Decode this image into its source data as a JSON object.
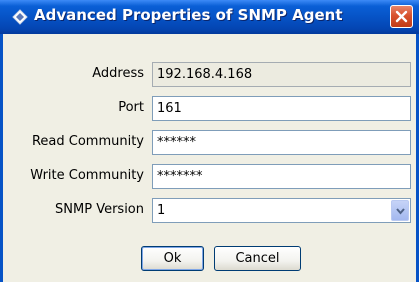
{
  "window": {
    "title": "Advanced Properties of SNMP Agent",
    "icon": "diamond-app-icon",
    "close_icon": "close-icon"
  },
  "form": {
    "address": {
      "label": "Address",
      "value": "192.168.4.168"
    },
    "port": {
      "label": "Port",
      "value": "161"
    },
    "read_community": {
      "label": "Read Community",
      "value": "******"
    },
    "write_community": {
      "label": "Write Community",
      "value": "*******"
    },
    "snmp_version": {
      "label": "SNMP Version",
      "value": "1"
    }
  },
  "buttons": {
    "ok_label": "Ok",
    "cancel_label": "Cancel"
  },
  "colors": {
    "titlebar": "#0653c6",
    "close_button": "#d8522e",
    "field_border": "#7f9db9"
  }
}
